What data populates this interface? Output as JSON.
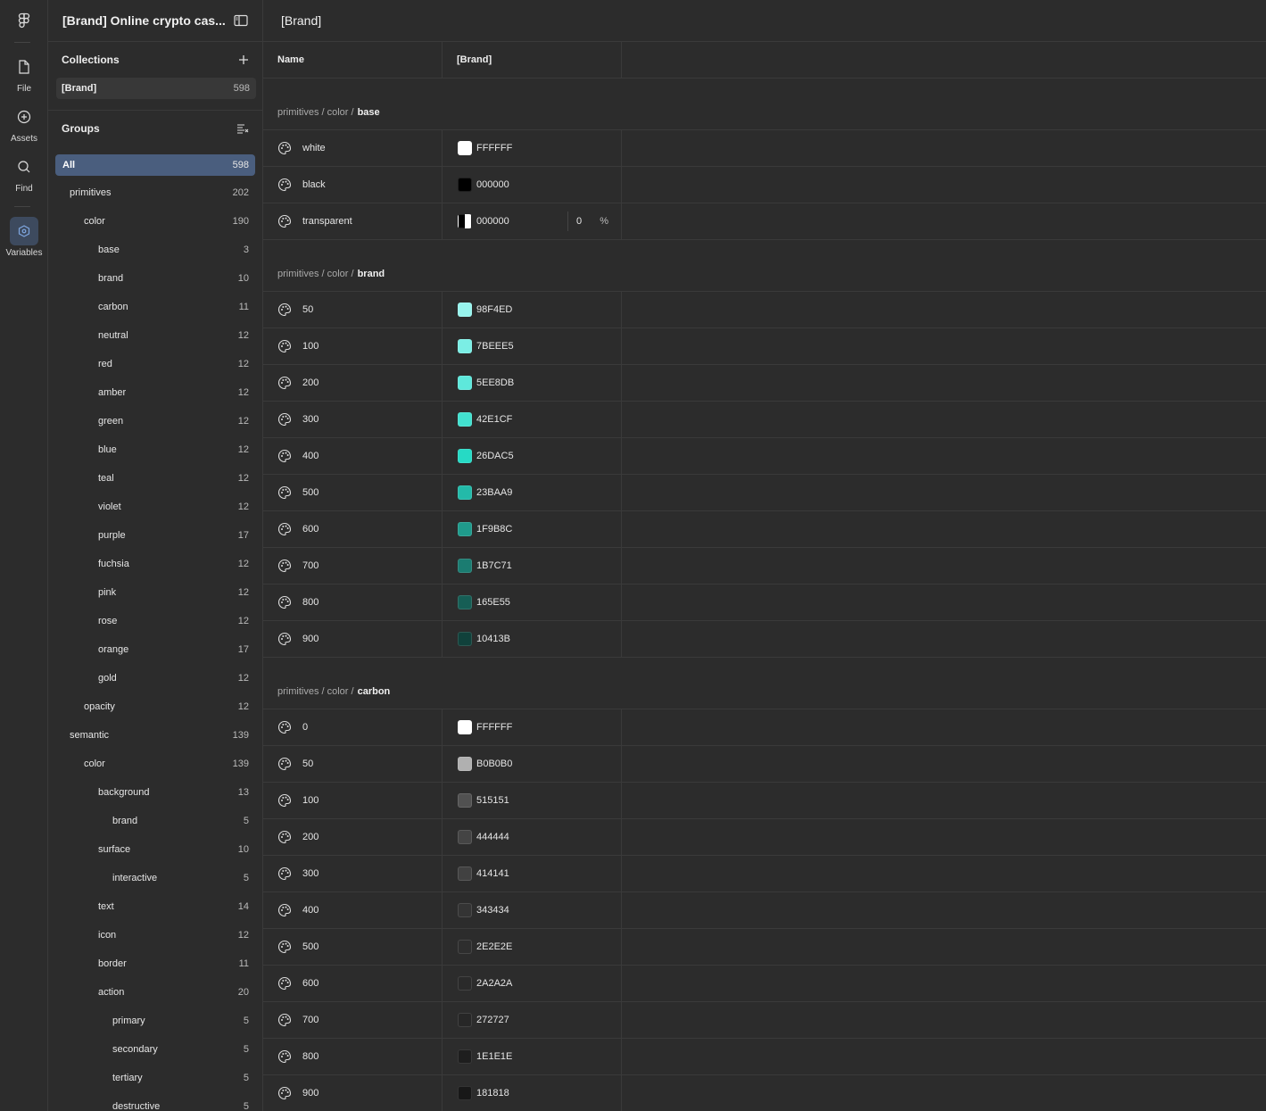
{
  "rail": {
    "items": [
      {
        "label": "File",
        "icon": "file-icon"
      },
      {
        "label": "Assets",
        "icon": "assets-icon"
      },
      {
        "label": "Find",
        "icon": "search-icon"
      },
      {
        "label": "Variables",
        "icon": "variables-icon"
      }
    ]
  },
  "sidebar": {
    "file_title": "[Brand] Online crypto cas...",
    "collections_label": "Collections",
    "collection": {
      "name": "[Brand]",
      "count": "598"
    },
    "groups_label": "Groups",
    "groups": [
      {
        "name": "All",
        "count": "598",
        "level": 0,
        "selected": true
      },
      {
        "name": "primitives",
        "count": "202",
        "level": 1
      },
      {
        "name": "color",
        "count": "190",
        "level": 2
      },
      {
        "name": "base",
        "count": "3",
        "level": 3
      },
      {
        "name": "brand",
        "count": "10",
        "level": 3
      },
      {
        "name": "carbon",
        "count": "11",
        "level": 3
      },
      {
        "name": "neutral",
        "count": "12",
        "level": 3
      },
      {
        "name": "red",
        "count": "12",
        "level": 3
      },
      {
        "name": "amber",
        "count": "12",
        "level": 3
      },
      {
        "name": "green",
        "count": "12",
        "level": 3
      },
      {
        "name": "blue",
        "count": "12",
        "level": 3
      },
      {
        "name": "teal",
        "count": "12",
        "level": 3
      },
      {
        "name": "violet",
        "count": "12",
        "level": 3
      },
      {
        "name": "purple",
        "count": "17",
        "level": 3
      },
      {
        "name": "fuchsia",
        "count": "12",
        "level": 3
      },
      {
        "name": "pink",
        "count": "12",
        "level": 3
      },
      {
        "name": "rose",
        "count": "12",
        "level": 3
      },
      {
        "name": "orange",
        "count": "17",
        "level": 3
      },
      {
        "name": "gold",
        "count": "12",
        "level": 3
      },
      {
        "name": "opacity",
        "count": "12",
        "level": 2
      },
      {
        "name": "semantic",
        "count": "139",
        "level": 1
      },
      {
        "name": "color",
        "count": "139",
        "level": 2
      },
      {
        "name": "background",
        "count": "13",
        "level": 3
      },
      {
        "name": "brand",
        "count": "5",
        "level": 4
      },
      {
        "name": "surface",
        "count": "10",
        "level": 3
      },
      {
        "name": "interactive",
        "count": "5",
        "level": 4
      },
      {
        "name": "text",
        "count": "14",
        "level": 3
      },
      {
        "name": "icon",
        "count": "12",
        "level": 3
      },
      {
        "name": "border",
        "count": "11",
        "level": 3
      },
      {
        "name": "action",
        "count": "20",
        "level": 3
      },
      {
        "name": "primary",
        "count": "5",
        "level": 4
      },
      {
        "name": "secondary",
        "count": "5",
        "level": 4
      },
      {
        "name": "tertiary",
        "count": "5",
        "level": 4
      },
      {
        "name": "destructive",
        "count": "5",
        "level": 4
      }
    ]
  },
  "main": {
    "title": "[Brand]",
    "col_name": "Name",
    "col_mode": "[Brand]",
    "sections": [
      {
        "path": "primitives / color /",
        "group": "base",
        "rows": [
          {
            "name": "white",
            "hex": "FFFFFF",
            "color": "#FFFFFF"
          },
          {
            "name": "black",
            "hex": "000000",
            "color": "#000000"
          },
          {
            "name": "transparent",
            "hex": "000000",
            "color": "transparent",
            "opacity": "0",
            "pct": "%"
          }
        ]
      },
      {
        "path": "primitives / color /",
        "group": "brand",
        "rows": [
          {
            "name": "50",
            "hex": "98F4ED",
            "color": "#98F4ED"
          },
          {
            "name": "100",
            "hex": "7BEEE5",
            "color": "#7BEEE5"
          },
          {
            "name": "200",
            "hex": "5EE8DB",
            "color": "#5EE8DB"
          },
          {
            "name": "300",
            "hex": "42E1CF",
            "color": "#42E1CF"
          },
          {
            "name": "400",
            "hex": "26DAC5",
            "color": "#26DAC5"
          },
          {
            "name": "500",
            "hex": "23BAA9",
            "color": "#23BAA9"
          },
          {
            "name": "600",
            "hex": "1F9B8C",
            "color": "#1F9B8C"
          },
          {
            "name": "700",
            "hex": "1B7C71",
            "color": "#1B7C71"
          },
          {
            "name": "800",
            "hex": "165E55",
            "color": "#165E55"
          },
          {
            "name": "900",
            "hex": "10413B",
            "color": "#10413B"
          }
        ]
      },
      {
        "path": "primitives / color /",
        "group": "carbon",
        "rows": [
          {
            "name": "0",
            "hex": "FFFFFF",
            "color": "#FFFFFF"
          },
          {
            "name": "50",
            "hex": "B0B0B0",
            "color": "#B0B0B0"
          },
          {
            "name": "100",
            "hex": "515151",
            "color": "#515151"
          },
          {
            "name": "200",
            "hex": "444444",
            "color": "#444444"
          },
          {
            "name": "300",
            "hex": "414141",
            "color": "#414141"
          },
          {
            "name": "400",
            "hex": "343434",
            "color": "#343434"
          },
          {
            "name": "500",
            "hex": "2E2E2E",
            "color": "#2E2E2E"
          },
          {
            "name": "600",
            "hex": "2A2A2A",
            "color": "#2A2A2A"
          },
          {
            "name": "700",
            "hex": "272727",
            "color": "#272727"
          },
          {
            "name": "800",
            "hex": "1E1E1E",
            "color": "#1E1E1E"
          },
          {
            "name": "900",
            "hex": "181818",
            "color": "#181818"
          }
        ]
      }
    ]
  }
}
